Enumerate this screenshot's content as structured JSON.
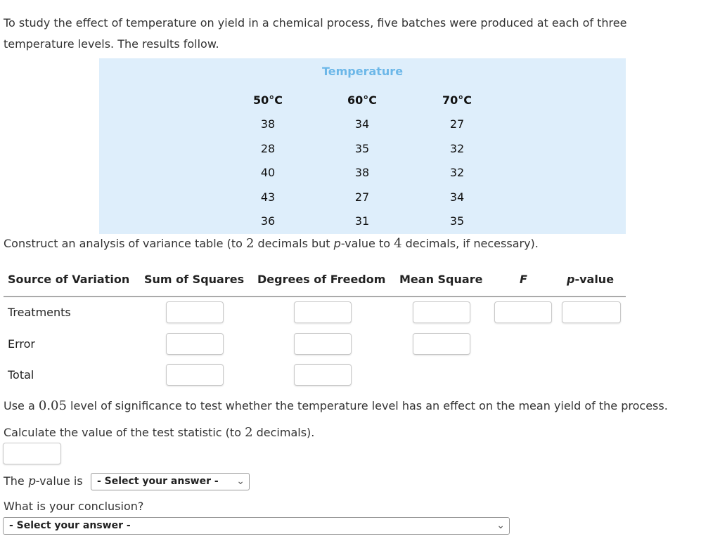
{
  "intro": {
    "line1": "To study the effect of temperature on yield in a chemical process, five batches were produced at each of three",
    "line2": "temperature levels. The results follow."
  },
  "data_table": {
    "title": "Temperature",
    "columns": [
      {
        "header": "50°C",
        "values": [
          "38",
          "28",
          "40",
          "43",
          "36"
        ]
      },
      {
        "header": "60°C",
        "values": [
          "34",
          "35",
          "38",
          "27",
          "31"
        ]
      },
      {
        "header": "70°C",
        "values": [
          "27",
          "32",
          "32",
          "34",
          "35"
        ]
      }
    ]
  },
  "construct": {
    "prefix": "Construct an analysis of variance table (to ",
    "num1": "2",
    "middle": " decimals but ",
    "p": "p",
    "middle2": "-value to ",
    "num2": "4",
    "suffix": " decimals, if necessary)."
  },
  "anova": {
    "headers": {
      "source": "Source of Variation",
      "ss": "Sum of Squares",
      "df": "Degrees of Freedom",
      "ms": "Mean Square",
      "f": "F",
      "p_italic": "p",
      "p_rest": "-value"
    },
    "rows": [
      {
        "label": "Treatments",
        "ss": "",
        "df": "",
        "ms": "",
        "f": "",
        "p": ""
      },
      {
        "label": "Error",
        "ss": "",
        "df": "",
        "ms": ""
      },
      {
        "label": "Total",
        "ss": "",
        "df": ""
      }
    ]
  },
  "significance": {
    "prefix": "Use a ",
    "alpha": "0.05",
    "suffix": " level of significance to test whether the temperature level has an effect on the mean yield of the process."
  },
  "test_stat": {
    "prefix": "Calculate the value of the test statistic (to ",
    "num": "2",
    "suffix": " decimals).",
    "value": ""
  },
  "pvalue": {
    "prefix": "The ",
    "p": "p",
    "suffix": "-value is",
    "selected": "- Select your answer -"
  },
  "conclusion": {
    "question": "What is your conclusion?",
    "selected": "- Select your answer -"
  }
}
